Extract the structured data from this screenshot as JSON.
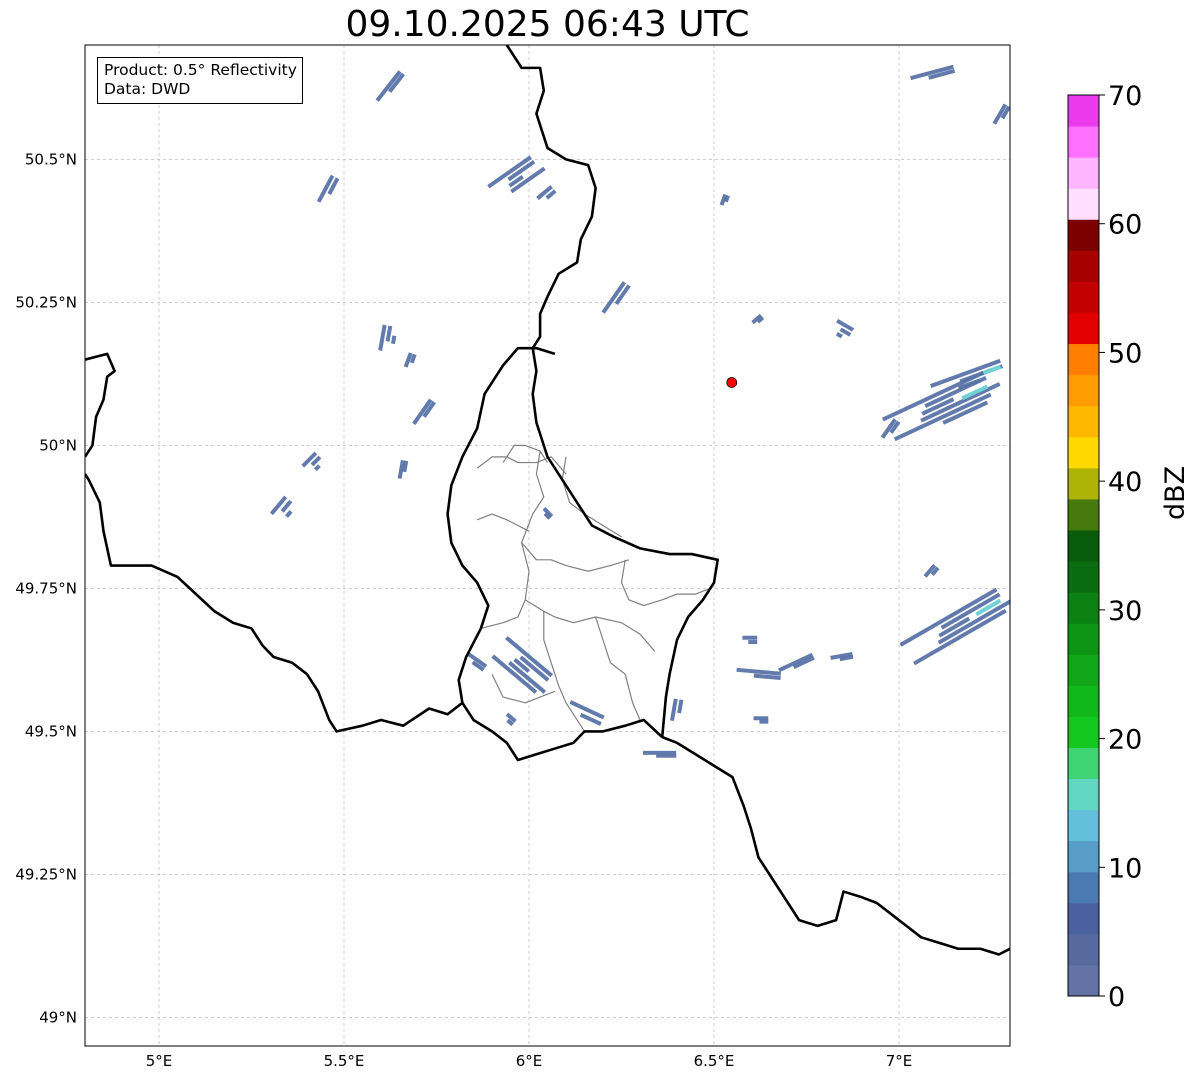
{
  "title": "09.10.2025 06:43 UTC",
  "info_box": {
    "product": "Product: 0.5° Reflectivity",
    "data": "Data: DWD"
  },
  "lon_ticks": [
    {
      "value": 5.0,
      "label": "5°E"
    },
    {
      "value": 5.5,
      "label": "5.5°E"
    },
    {
      "value": 6.0,
      "label": "6°E"
    },
    {
      "value": 6.5,
      "label": "6.5°E"
    },
    {
      "value": 7.0,
      "label": "7°E"
    }
  ],
  "lat_ticks": [
    {
      "value": 50.5,
      "label": "50.5°N"
    },
    {
      "value": 50.25,
      "label": "50.25°N"
    },
    {
      "value": 50.0,
      "label": "50°N"
    },
    {
      "value": 49.75,
      "label": "49.75°N"
    },
    {
      "value": 49.5,
      "label": "49.5°N"
    },
    {
      "value": 49.25,
      "label": "49.25°N"
    },
    {
      "value": 49.0,
      "label": "49°N"
    }
  ],
  "map_extent": {
    "lon_min": 4.8,
    "lon_max": 7.3,
    "lat_min": 48.95,
    "lat_max": 50.7
  },
  "radar_site": {
    "lon": 6.548,
    "lat": 50.11,
    "color": "#ff0000"
  },
  "colorbar": {
    "label": "dBZ",
    "min": 0,
    "max": 70,
    "tick_labels": [
      "0",
      "10",
      "20",
      "30",
      "40",
      "50",
      "60",
      "70"
    ],
    "colors": [
      "#6473a5",
      "#5869a0",
      "#4a609f",
      "#4b7ab2",
      "#579dc7",
      "#64bfdc",
      "#61d6c1",
      "#3ed474",
      "#12c81e",
      "#11b819",
      "#10a618",
      "#0e9414",
      "#0c8012",
      "#0a6c10",
      "#095c0c",
      "#467a0c",
      "#aeb306",
      "#ffd800",
      "#ffb800",
      "#ff9c00",
      "#ff7f00",
      "#e40000",
      "#c30000",
      "#a60000",
      "#7c0000",
      "#ffdeff",
      "#ffb4ff",
      "#ff70ff",
      "#eb3aeb"
    ]
  },
  "echo_color": "#5a74a8",
  "echo_strong_color": "#6fd2d6",
  "echo_cells": [
    {
      "lon": 5.63,
      "lat": 50.63,
      "len": 0.1,
      "w": 0.015,
      "ang": 52
    },
    {
      "lon": 5.46,
      "lat": 50.45,
      "len": 0.08,
      "w": 0.02,
      "ang": 62
    },
    {
      "lon": 5.97,
      "lat": 50.47,
      "len": 0.14,
      "w": 0.04,
      "ang": 35
    },
    {
      "lon": 6.05,
      "lat": 50.44,
      "len": 0.05,
      "w": 0.02,
      "ang": 40
    },
    {
      "lon": 6.24,
      "lat": 50.26,
      "len": 0.1,
      "w": 0.02,
      "ang": 55
    },
    {
      "lon": 5.62,
      "lat": 50.19,
      "len": 0.07,
      "w": 0.03,
      "ang": 80
    },
    {
      "lon": 5.68,
      "lat": 50.15,
      "len": 0.04,
      "w": 0.015,
      "ang": 70
    },
    {
      "lon": 5.72,
      "lat": 50.06,
      "len": 0.08,
      "w": 0.015,
      "ang": 55
    },
    {
      "lon": 5.42,
      "lat": 49.97,
      "len": 0.05,
      "w": 0.03,
      "ang": 45
    },
    {
      "lon": 5.34,
      "lat": 49.89,
      "len": 0.06,
      "w": 0.035,
      "ang": 50
    },
    {
      "lon": 5.66,
      "lat": 49.96,
      "len": 0.05,
      "w": 0.012,
      "ang": 80
    },
    {
      "lon": 5.99,
      "lat": 49.61,
      "len": 0.16,
      "w": 0.05,
      "ang": -40
    },
    {
      "lon": 5.86,
      "lat": 49.62,
      "len": 0.06,
      "w": 0.015,
      "ang": -35
    },
    {
      "lon": 6.16,
      "lat": 49.53,
      "len": 0.1,
      "w": 0.025,
      "ang": -25
    },
    {
      "lon": 5.95,
      "lat": 49.52,
      "len": 0.03,
      "w": 0.015,
      "ang": -40
    },
    {
      "lon": 6.05,
      "lat": 49.88,
      "len": 0.03,
      "w": 0.01,
      "ang": -45
    },
    {
      "lon": 6.4,
      "lat": 49.54,
      "len": 0.06,
      "w": 0.02,
      "ang": 80
    },
    {
      "lon": 6.36,
      "lat": 49.46,
      "len": 0.09,
      "w": 0.01,
      "ang": 0
    },
    {
      "lon": 6.85,
      "lat": 50.2,
      "len": 0.05,
      "w": 0.03,
      "ang": -30
    },
    {
      "lon": 6.98,
      "lat": 50.03,
      "len": 0.06,
      "w": 0.015,
      "ang": 55
    },
    {
      "lon": 7.13,
      "lat": 50.07,
      "len": 0.3,
      "w": 0.06,
      "ang": 25
    },
    {
      "lon": 7.2,
      "lat": 50.12,
      "len": 0.2,
      "w": 0.03,
      "ang": 20
    },
    {
      "lon": 7.17,
      "lat": 49.69,
      "len": 0.3,
      "w": 0.05,
      "ang": 30
    },
    {
      "lon": 7.09,
      "lat": 49.78,
      "len": 0.04,
      "w": 0.015,
      "ang": 50
    },
    {
      "lon": 6.63,
      "lat": 49.6,
      "len": 0.12,
      "w": 0.015,
      "ang": -5
    },
    {
      "lon": 6.73,
      "lat": 49.62,
      "len": 0.1,
      "w": 0.012,
      "ang": 25
    },
    {
      "lon": 6.85,
      "lat": 49.63,
      "len": 0.06,
      "w": 0.01,
      "ang": 10
    },
    {
      "lon": 6.6,
      "lat": 49.66,
      "len": 0.04,
      "w": 0.015,
      "ang": 0
    },
    {
      "lon": 6.63,
      "lat": 49.52,
      "len": 0.04,
      "w": 0.012,
      "ang": 0
    },
    {
      "lon": 7.1,
      "lat": 50.65,
      "len": 0.12,
      "w": 0.015,
      "ang": 15
    },
    {
      "lon": 7.28,
      "lat": 50.58,
      "len": 0.06,
      "w": 0.015,
      "ang": 60
    },
    {
      "lon": 6.53,
      "lat": 50.43,
      "len": 0.03,
      "w": 0.01,
      "ang": 70
    },
    {
      "lon": 6.62,
      "lat": 50.22,
      "len": 0.03,
      "w": 0.01,
      "ang": 40
    }
  ],
  "borders_black": [
    [
      [
        5.94,
        50.7
      ],
      [
        5.98,
        50.66
      ],
      [
        6.03,
        50.66
      ],
      [
        6.04,
        50.62
      ],
      [
        6.02,
        50.58
      ],
      [
        6.05,
        50.52
      ],
      [
        6.1,
        50.5
      ],
      [
        6.16,
        50.49
      ],
      [
        6.18,
        50.45
      ],
      [
        6.17,
        50.4
      ],
      [
        6.14,
        50.36
      ],
      [
        6.13,
        50.32
      ],
      [
        6.08,
        50.3
      ],
      [
        6.05,
        50.26
      ],
      [
        6.03,
        50.23
      ],
      [
        6.03,
        50.19
      ],
      [
        6.01,
        50.17
      ],
      [
        6.02,
        50.13
      ],
      [
        6.01,
        50.09
      ],
      [
        6.02,
        50.04
      ],
      [
        6.05,
        49.98
      ],
      [
        6.1,
        49.93
      ],
      [
        6.14,
        49.89
      ],
      [
        6.17,
        49.86
      ],
      [
        6.23,
        49.84
      ],
      [
        6.3,
        49.82
      ],
      [
        6.38,
        49.81
      ],
      [
        6.44,
        49.81
      ],
      [
        6.51,
        49.8
      ],
      [
        6.5,
        49.76
      ],
      [
        6.47,
        49.73
      ],
      [
        6.43,
        49.7
      ],
      [
        6.4,
        49.66
      ],
      [
        6.38,
        49.6
      ],
      [
        6.37,
        49.56
      ],
      [
        6.36,
        49.49
      ]
    ],
    [
      [
        6.36,
        49.49
      ],
      [
        6.31,
        49.52
      ],
      [
        6.26,
        49.51
      ],
      [
        6.2,
        49.5
      ],
      [
        6.15,
        49.5
      ],
      [
        6.12,
        49.48
      ],
      [
        6.07,
        49.47
      ],
      [
        6.02,
        49.46
      ],
      [
        5.97,
        49.45
      ],
      [
        5.94,
        49.48
      ],
      [
        5.9,
        49.5
      ],
      [
        5.85,
        49.52
      ],
      [
        5.82,
        49.55
      ],
      [
        5.81,
        49.59
      ],
      [
        5.83,
        49.63
      ],
      [
        5.87,
        49.68
      ],
      [
        5.89,
        49.72
      ],
      [
        5.86,
        49.76
      ],
      [
        5.82,
        49.79
      ],
      [
        5.79,
        49.83
      ],
      [
        5.78,
        49.88
      ],
      [
        5.79,
        49.93
      ],
      [
        5.82,
        49.98
      ],
      [
        5.86,
        50.03
      ],
      [
        5.88,
        50.09
      ],
      [
        5.93,
        50.14
      ],
      [
        5.97,
        50.17
      ],
      [
        6.02,
        50.17
      ],
      [
        6.07,
        50.16
      ]
    ],
    [
      [
        6.36,
        49.49
      ],
      [
        6.4,
        49.48
      ],
      [
        6.45,
        49.46
      ],
      [
        6.5,
        49.44
      ],
      [
        6.55,
        49.42
      ],
      [
        6.58,
        49.37
      ],
      [
        6.6,
        49.33
      ],
      [
        6.62,
        49.28
      ],
      [
        6.66,
        49.24
      ],
      [
        6.7,
        49.2
      ],
      [
        6.73,
        49.17
      ],
      [
        6.78,
        49.16
      ],
      [
        6.83,
        49.17
      ],
      [
        6.85,
        49.22
      ],
      [
        6.9,
        49.21
      ],
      [
        6.94,
        49.2
      ],
      [
        6.98,
        49.18
      ],
      [
        7.02,
        49.16
      ],
      [
        7.06,
        49.14
      ],
      [
        7.11,
        49.13
      ],
      [
        7.16,
        49.12
      ],
      [
        7.22,
        49.12
      ],
      [
        7.27,
        49.11
      ],
      [
        7.3,
        49.12
      ]
    ],
    [
      [
        5.82,
        49.55
      ],
      [
        5.78,
        49.53
      ],
      [
        5.73,
        49.54
      ],
      [
        5.66,
        49.51
      ],
      [
        5.6,
        49.52
      ],
      [
        5.55,
        49.51
      ],
      [
        5.48,
        49.5
      ],
      [
        5.46,
        49.52
      ],
      [
        5.43,
        49.57
      ],
      [
        5.4,
        49.6
      ],
      [
        5.36,
        49.62
      ],
      [
        5.31,
        49.63
      ],
      [
        5.28,
        49.65
      ],
      [
        5.25,
        49.68
      ],
      [
        5.2,
        49.69
      ],
      [
        5.15,
        49.71
      ],
      [
        5.1,
        49.74
      ],
      [
        5.05,
        49.77
      ],
      [
        4.98,
        49.79
      ],
      [
        4.92,
        49.79
      ],
      [
        4.87,
        49.79
      ],
      [
        4.85,
        49.85
      ],
      [
        4.84,
        49.9
      ],
      [
        4.81,
        49.94
      ],
      [
        4.8,
        49.95
      ]
    ],
    [
      [
        4.8,
        49.98
      ],
      [
        4.82,
        50.0
      ],
      [
        4.83,
        50.05
      ],
      [
        4.85,
        50.08
      ],
      [
        4.86,
        50.12
      ],
      [
        4.88,
        50.13
      ],
      [
        4.86,
        50.16
      ],
      [
        4.8,
        50.15
      ]
    ]
  ],
  "borders_grey": [
    [
      [
        5.86,
        49.87
      ],
      [
        5.9,
        49.88
      ],
      [
        5.94,
        49.87
      ],
      [
        5.97,
        49.86
      ],
      [
        6.0,
        49.85
      ]
    ],
    [
      [
        5.86,
        49.96
      ],
      [
        5.9,
        49.98
      ],
      [
        5.94,
        49.98
      ],
      [
        5.97,
        49.97
      ],
      [
        6.02,
        49.97
      ],
      [
        6.06,
        49.98
      ],
      [
        6.1,
        49.95
      ]
    ],
    [
      [
        5.93,
        49.97
      ],
      [
        5.96,
        50.0
      ],
      [
        5.99,
        50.0
      ],
      [
        6.03,
        49.99
      ],
      [
        6.05,
        49.97
      ]
    ],
    [
      [
        6.03,
        49.99
      ],
      [
        6.02,
        49.95
      ],
      [
        6.04,
        49.91
      ],
      [
        6.01,
        49.88
      ],
      [
        5.98,
        49.83
      ],
      [
        6.02,
        49.8
      ],
      [
        6.06,
        49.8
      ],
      [
        6.1,
        49.79
      ],
      [
        6.16,
        49.78
      ],
      [
        6.22,
        49.79
      ],
      [
        6.27,
        49.8
      ]
    ],
    [
      [
        6.1,
        49.98
      ],
      [
        6.09,
        49.94
      ],
      [
        6.11,
        49.9
      ],
      [
        6.15,
        49.88
      ],
      [
        6.2,
        49.86
      ],
      [
        6.25,
        49.84
      ]
    ],
    [
      [
        5.98,
        49.83
      ],
      [
        6.0,
        49.78
      ],
      [
        5.99,
        49.73
      ],
      [
        5.97,
        49.7
      ],
      [
        5.93,
        49.69
      ],
      [
        5.87,
        49.68
      ]
    ],
    [
      [
        5.99,
        49.73
      ],
      [
        6.04,
        49.71
      ],
      [
        6.07,
        49.7
      ],
      [
        6.12,
        49.69
      ],
      [
        6.18,
        49.7
      ],
      [
        6.25,
        49.69
      ],
      [
        6.3,
        49.67
      ],
      [
        6.34,
        49.64
      ]
    ],
    [
      [
        6.26,
        49.8
      ],
      [
        6.25,
        49.76
      ],
      [
        6.27,
        49.73
      ],
      [
        6.31,
        49.72
      ],
      [
        6.36,
        49.73
      ],
      [
        6.4,
        49.74
      ],
      [
        6.45,
        49.74
      ],
      [
        6.49,
        49.75
      ]
    ],
    [
      [
        6.18,
        49.7
      ],
      [
        6.2,
        49.66
      ],
      [
        6.22,
        49.62
      ],
      [
        6.26,
        49.6
      ],
      [
        6.28,
        49.55
      ],
      [
        6.3,
        49.52
      ]
    ],
    [
      [
        6.04,
        49.71
      ],
      [
        6.04,
        49.66
      ],
      [
        6.06,
        49.62
      ],
      [
        6.08,
        49.58
      ],
      [
        6.1,
        49.55
      ],
      [
        6.13,
        49.52
      ],
      [
        6.15,
        49.5
      ]
    ],
    [
      [
        5.9,
        49.6
      ],
      [
        5.93,
        49.56
      ],
      [
        5.99,
        49.55
      ],
      [
        6.03,
        49.56
      ],
      [
        6.07,
        49.57
      ]
    ]
  ]
}
